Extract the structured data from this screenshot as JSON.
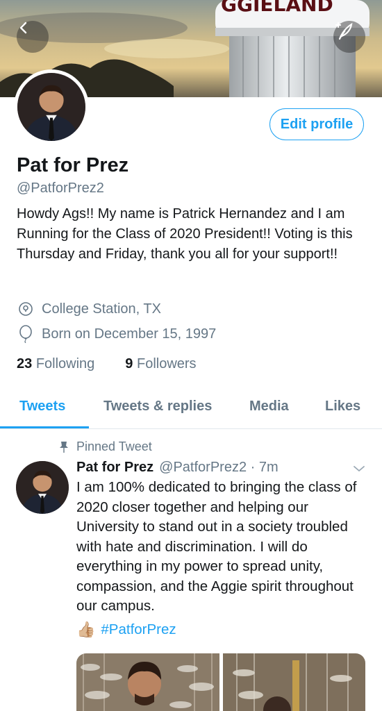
{
  "banner": {
    "tower_text": "GGIELAND",
    "back_icon": "chevron-left-icon",
    "compose_icon": "compose-feather-icon"
  },
  "profile": {
    "edit_label": "Edit profile",
    "name": "Pat for Prez",
    "handle": "@PatforPrez2",
    "bio": "Howdy Ags!! My name is Patrick Hernandez and I am Running for the Class of 2020 President!! Voting is this Thursday and Friday, thank you all for your support!!",
    "location": "College Station, TX",
    "location_icon": "location-pin-icon",
    "born": "Born on December 15, 1997",
    "born_icon": "balloon-icon",
    "following_count": "23",
    "following_label": "Following",
    "followers_count": "9",
    "followers_label": "Followers"
  },
  "tabs": [
    {
      "label": "Tweets",
      "active": true
    },
    {
      "label": "Tweets & replies",
      "active": false
    },
    {
      "label": "Media",
      "active": false
    },
    {
      "label": "Likes",
      "active": false
    }
  ],
  "tweet": {
    "pinned_label": "Pinned Tweet",
    "name": "Pat for Prez",
    "handle_time": "@PatforPrez2 · 7m",
    "text": "I am 100% dedicated to bringing the class of 2020 closer together and helping our University to stand out in a society troubled with hate and discrimination. I will do everything in my power to spread unity, compassion, and the Aggie spirit throughout our campus.",
    "emoji": "👍🏼",
    "hashtag": "#PatforPrez"
  },
  "colors": {
    "accent": "#1da1f2",
    "secondary_text": "#657786",
    "primary_text": "#14171a"
  }
}
